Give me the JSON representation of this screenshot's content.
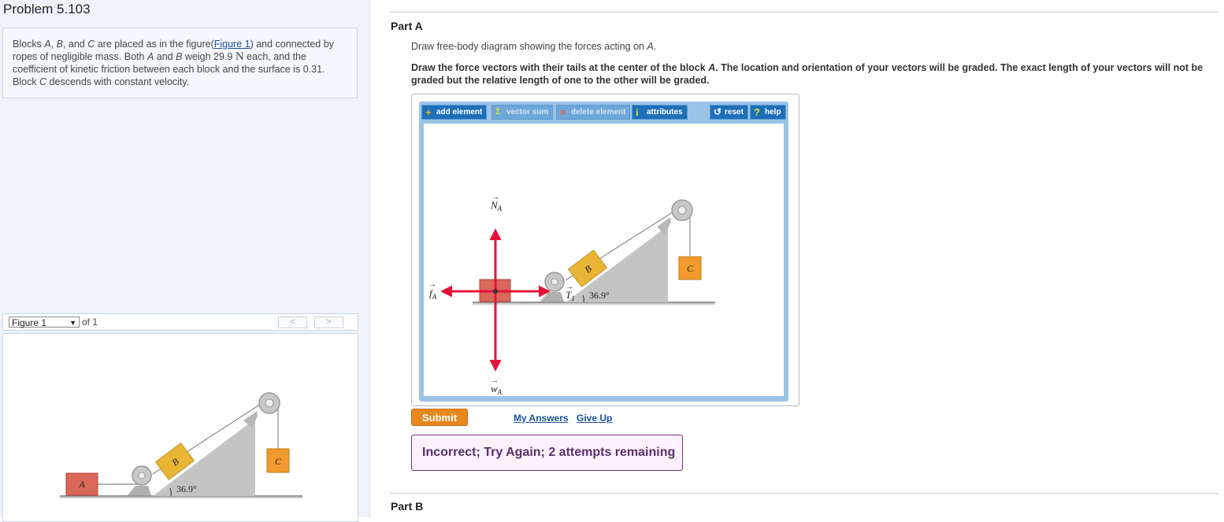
{
  "problem": {
    "title": "Problem 5.103",
    "text_1": "Blocks ",
    "text_A": "A",
    "text_2": ", ",
    "text_B": "B",
    "text_3": ", and ",
    "text_C": "C",
    "text_4": " are placed as in the figure(",
    "figure_link": "Figure 1",
    "text_5": ") and connected by ropes of negligible mass. Both ",
    "text_A2": "A",
    "text_6": " and ",
    "text_B2": "B",
    "text_7": " weigh 29.9 ",
    "unit_N": "N",
    "text_8": " each, and the coefficient of kinetic friction between each block and the surface is 0.31. Block ",
    "text_C2": "C",
    "text_9": " descends with constant velocity."
  },
  "figure_nav": {
    "selected": "Figure 1",
    "of_label": "of 1",
    "prev": "<",
    "next": ">"
  },
  "figure": {
    "label_A": "A",
    "label_B": "B",
    "label_C": "C",
    "angle": "36.9°"
  },
  "part_a": {
    "label": "Part A",
    "instruction_1a": "Draw free-body diagram showing the forces acting on ",
    "instruction_1b": "A",
    "instruction_1c": ".",
    "instruction_2a": "Draw the force vectors with their tails at the center of the block ",
    "instruction_2b": "A",
    "instruction_2c": ". The location and orientation of your vectors will be graded. The exact length of your vectors will not be graded but the relative length of one to the other will be graded."
  },
  "toolbar": {
    "add_element": "add element",
    "vector_sum": "vector sum",
    "delete_element": "delete element",
    "attributes": "attributes",
    "reset": "reset",
    "help": "help"
  },
  "vectors": {
    "normal": "N",
    "normal_sub": "A",
    "friction": "f",
    "friction_sub": "A",
    "tension": "T",
    "tension_sub": "1",
    "weight": "w",
    "weight_sub": "A"
  },
  "actions": {
    "submit": "Submit",
    "my_answers": "My Answers",
    "give_up": "Give Up"
  },
  "feedback": "Incorrect; Try Again; 2 attempts remaining",
  "part_b": {
    "label": "Part B"
  },
  "colors": {
    "vector_red": "#e8113a",
    "block_a": "#d9675a",
    "block_b": "#e9b536",
    "block_c": "#f29a2e",
    "submit_orange": "#e8871e",
    "toolbar_blue": "#1e6fb8"
  }
}
